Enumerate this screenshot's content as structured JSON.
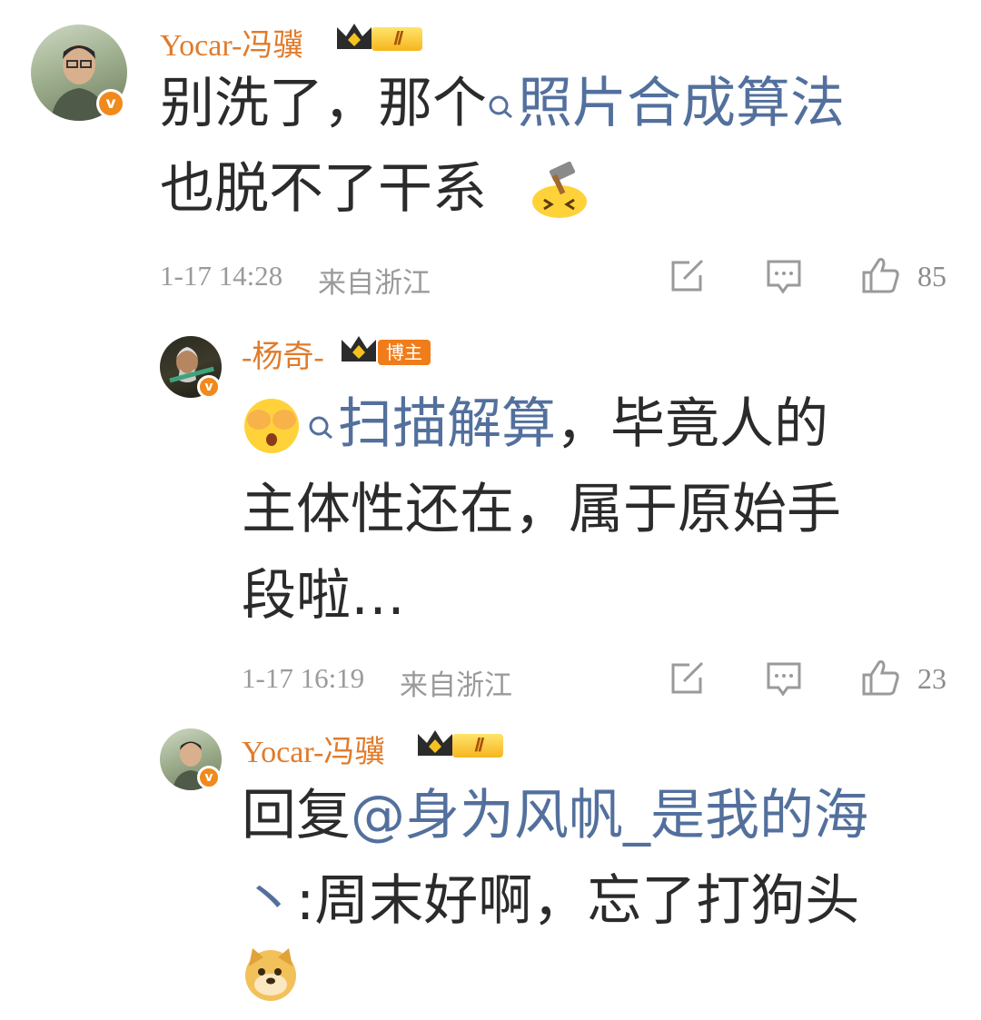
{
  "comments": [
    {
      "user": "Yocar-冯骥",
      "badge": "Ⅱ",
      "line1_a": "别洗了，那个",
      "search_term": "照片合成算法",
      "line2": "也脱不了干系",
      "time": "1-17 14:28",
      "location": "来自浙江",
      "likes": "85"
    },
    {
      "user": "-杨奇-",
      "badge": "博主",
      "search_term": "扫描解算",
      "line1_b": "，毕竟人的",
      "line2": "主体性还在，属于原始手",
      "line3": "段啦…",
      "time": "1-17 16:19",
      "location": "来自浙江",
      "likes": "23"
    },
    {
      "user": "Yocar-冯骥",
      "badge": "Ⅱ",
      "reply_prefix": "回复",
      "mention_line1": "@身为风帆_是我的海",
      "mention_line2": "丶",
      "reply_rest": ":周末好啊，忘了打狗头"
    }
  ],
  "icons": [
    "crown-icon",
    "search-icon",
    "hammer-emoji",
    "cover-eyes-emoji",
    "doge-emoji",
    "share-icon",
    "comment-icon",
    "like-icon",
    "verified-badge"
  ],
  "colors": {
    "name": "#e07b2b",
    "link": "#53709d",
    "meta": "#9a9a9a",
    "badge": "#f08a1c"
  }
}
